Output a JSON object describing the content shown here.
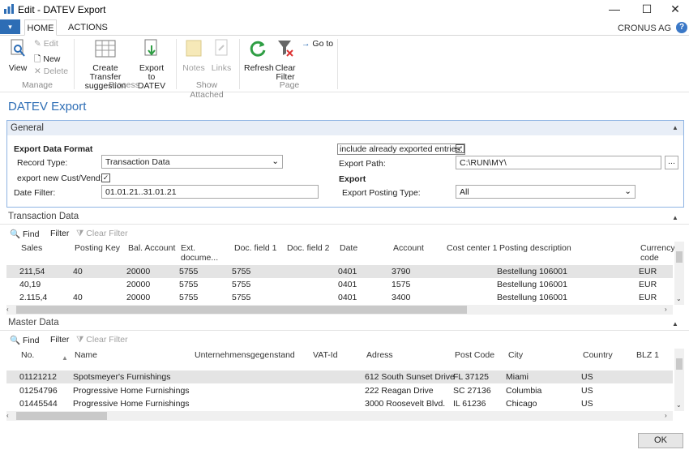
{
  "window": {
    "title": "Edit - DATEV Export",
    "minimize": "—",
    "maximize": "☐",
    "close": "✕"
  },
  "menu": {
    "arrow": "▾",
    "tabs": [
      "HOME",
      "ACTIONS"
    ],
    "company": "CRONUS AG",
    "help": "?"
  },
  "ribbon": {
    "manage": {
      "view": "View",
      "edit": "Edit",
      "new": "New",
      "delete": "Delete",
      "group": "Manage"
    },
    "process": {
      "create_line1": "Create Transfer",
      "create_line2": "suggestion",
      "export_line1": "Export to",
      "export_line2": "DATEV",
      "group": "Process"
    },
    "attached": {
      "notes": "Notes",
      "links": "Links",
      "group": "Show Attached"
    },
    "page": {
      "refresh": "Refresh",
      "clear_line1": "Clear",
      "clear_line2": "Filter",
      "goto": "Go to",
      "group": "Page"
    }
  },
  "page_title": "DATEV Export",
  "general": {
    "title": "General",
    "export_data_format": "Export Data Format",
    "record_type_label": "Record Type:",
    "record_type_value": "Transaction Data",
    "export_new_label": "export new Cust/Vend:",
    "date_filter_label": "Date Filter:",
    "date_filter_value": "01.01.21..31.01.21",
    "include_label": "include already exported entries:",
    "export_path_label": "Export Path:",
    "export_path_value": "C:\\RUN\\MY\\",
    "export_path_btn": "...",
    "export_heading": "Export",
    "posting_type_label": "Export Posting Type:",
    "posting_type_value": "All"
  },
  "transaction": {
    "title": "Transaction Data",
    "toolbar": {
      "find": "Find",
      "filter": "Filter",
      "clear_filter": "Clear Filter"
    },
    "columns": [
      "Sales",
      "Posting Key",
      "Bal. Account",
      "Ext. docume...",
      "Doc. field 1",
      "Doc. field 2",
      "Date",
      "Account",
      "Cost center 1",
      "Posting description",
      "Currency code"
    ],
    "rows": [
      [
        "211,54",
        "40",
        "20000",
        "5755",
        "5755",
        "",
        "0401",
        "3790",
        "",
        "Bestellung 106001",
        "EUR"
      ],
      [
        "40,19",
        "",
        "20000",
        "5755",
        "5755",
        "",
        "0401",
        "1575",
        "",
        "Bestellung 106001",
        "EUR"
      ],
      [
        "2.115,4",
        "40",
        "20000",
        "5755",
        "5755",
        "",
        "0401",
        "3400",
        "",
        "Bestellung 106001",
        "EUR"
      ]
    ]
  },
  "master": {
    "title": "Master Data",
    "toolbar": {
      "find": "Find",
      "filter": "Filter",
      "clear_filter": "Clear Filter"
    },
    "columns": [
      "No.",
      "Name",
      "Unternehmensgegenstand",
      "VAT-Id",
      "Adress",
      "Post Code",
      "City",
      "Country",
      "BLZ 1"
    ],
    "rows": [
      [
        "01121212",
        "Spotsmeyer's Furnishings",
        "",
        "",
        "612 South Sunset Drive",
        "FL 37125",
        "Miami",
        "US",
        ""
      ],
      [
        "01254796",
        "Progressive Home Furnishings",
        "",
        "",
        "222 Reagan Drive",
        "SC 27136",
        "Columbia",
        "US",
        ""
      ],
      [
        "01445544",
        "Progressive Home Furnishings",
        "",
        "",
        "3000 Roosevelt Blvd.",
        "IL 61236",
        "Chicago",
        "US",
        ""
      ]
    ]
  },
  "ok": "OK",
  "colors": {
    "accent": "#2d6db5",
    "selected_row": "#e4e4e4"
  }
}
